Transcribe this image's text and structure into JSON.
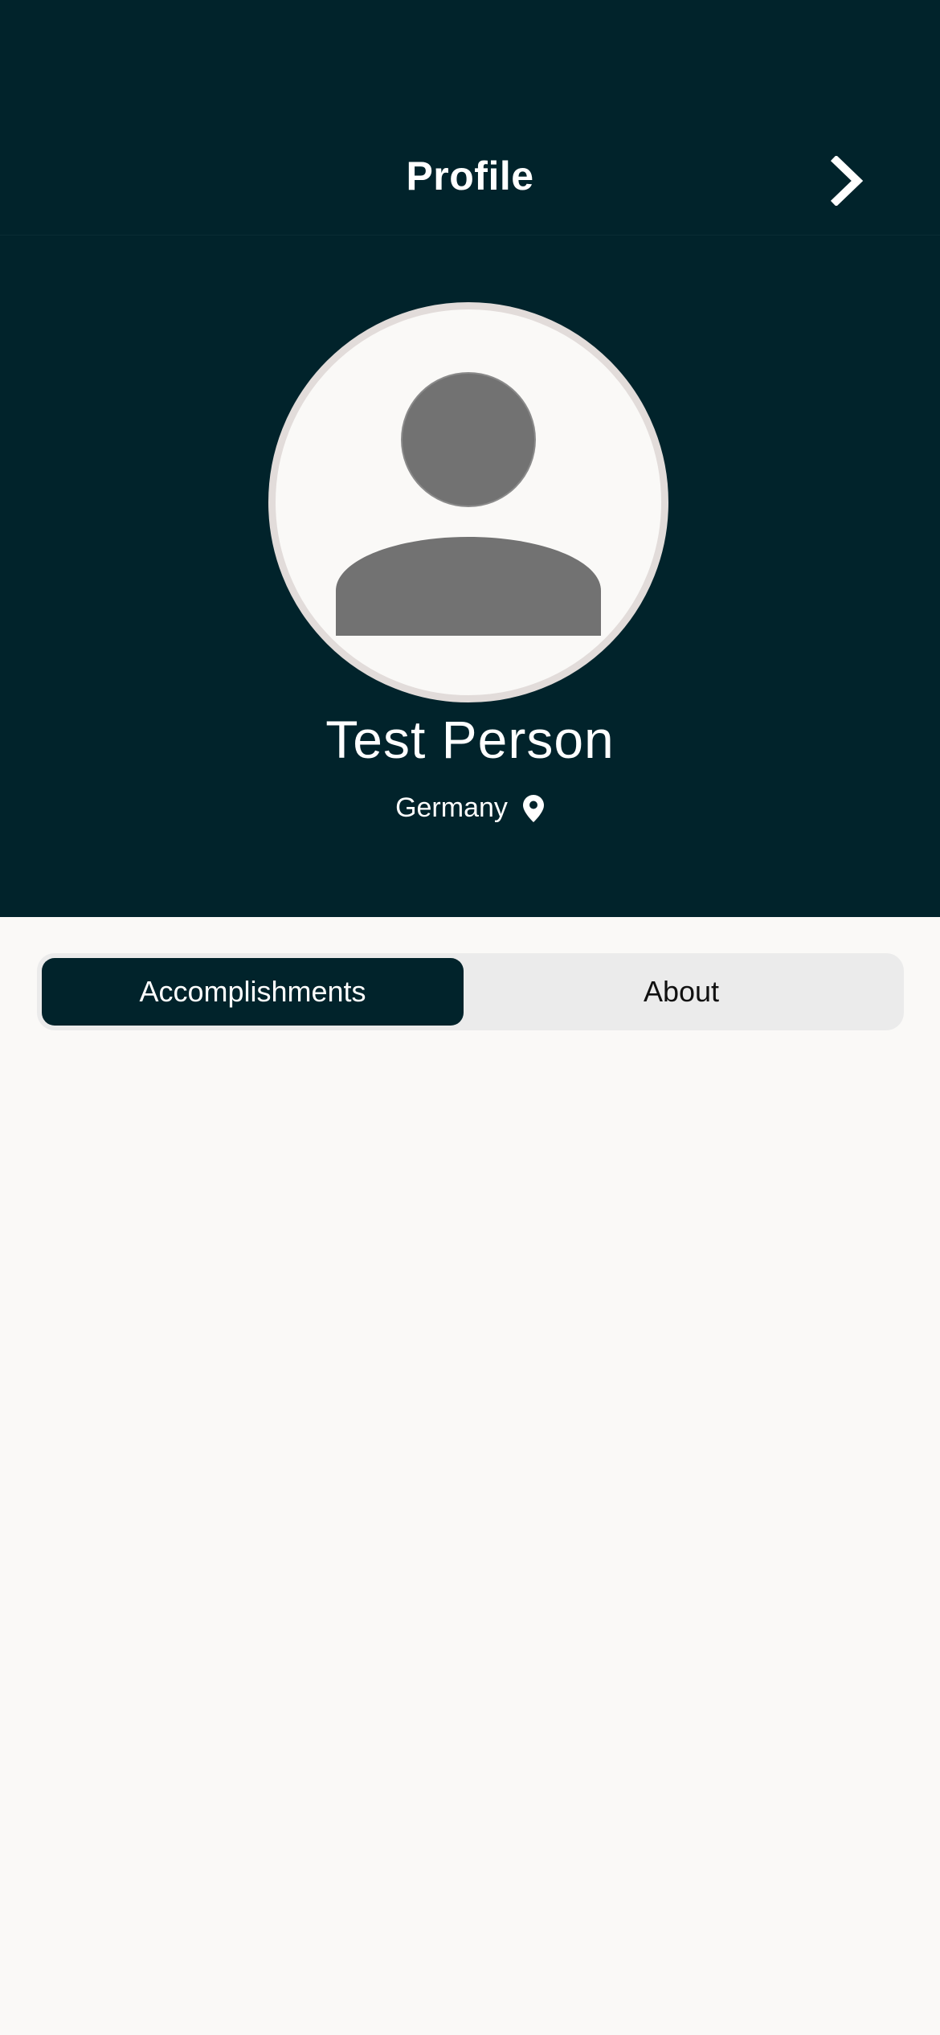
{
  "header": {
    "title": "Profile",
    "forward_icon": "chevron-right-icon",
    "background_color": "#01232b"
  },
  "profile": {
    "avatar_icon": "person-placeholder-icon",
    "name": "Test Person",
    "location": "Germany",
    "location_icon": "map-pin-icon"
  },
  "tabs": {
    "items": [
      {
        "label": "Accomplishments",
        "selected": true
      },
      {
        "label": "About",
        "selected": false
      }
    ],
    "active_color": "#01232b"
  }
}
